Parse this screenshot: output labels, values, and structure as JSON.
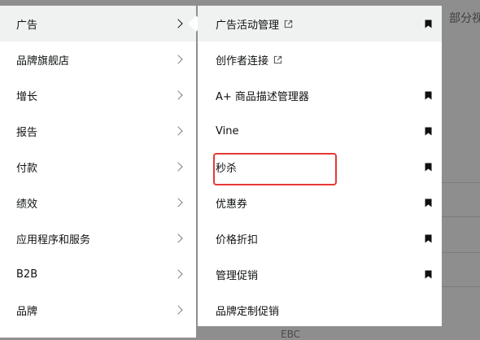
{
  "background": {
    "header_text": "部分视",
    "bottom_text": "EBC"
  },
  "left_menu": {
    "items": [
      {
        "label": "广告"
      },
      {
        "label": "品牌旗舰店"
      },
      {
        "label": "增长"
      },
      {
        "label": "报告"
      },
      {
        "label": "付款"
      },
      {
        "label": "绩效"
      },
      {
        "label": "应用程序和服务"
      },
      {
        "label": "B2B"
      },
      {
        "label": "品牌"
      }
    ]
  },
  "submenu": {
    "items": [
      {
        "label": "广告活动管理",
        "icon": "external-link-icon",
        "bookmark": "bookmark-icon"
      },
      {
        "label": "创作者连接",
        "icon": "external-link-icon"
      },
      {
        "label": "A+ 商品描述管理器",
        "bookmark": "bookmark-icon"
      },
      {
        "label": "Vine",
        "bookmark": "bookmark-icon"
      },
      {
        "label": "秒杀",
        "bookmark": "bookmark-icon"
      },
      {
        "label": "优惠券",
        "bookmark": "bookmark-icon"
      },
      {
        "label": "价格折扣",
        "bookmark": "bookmark-icon"
      },
      {
        "label": "管理促销",
        "bookmark": "bookmark-icon"
      },
      {
        "label": "品牌定制促销"
      }
    ]
  },
  "colors": {
    "overlay": "#8f8f8f",
    "menu_bg": "#ffffff",
    "active_bg": "#f0f2f2",
    "annotation": "#e53935",
    "text": "#0f1111"
  }
}
